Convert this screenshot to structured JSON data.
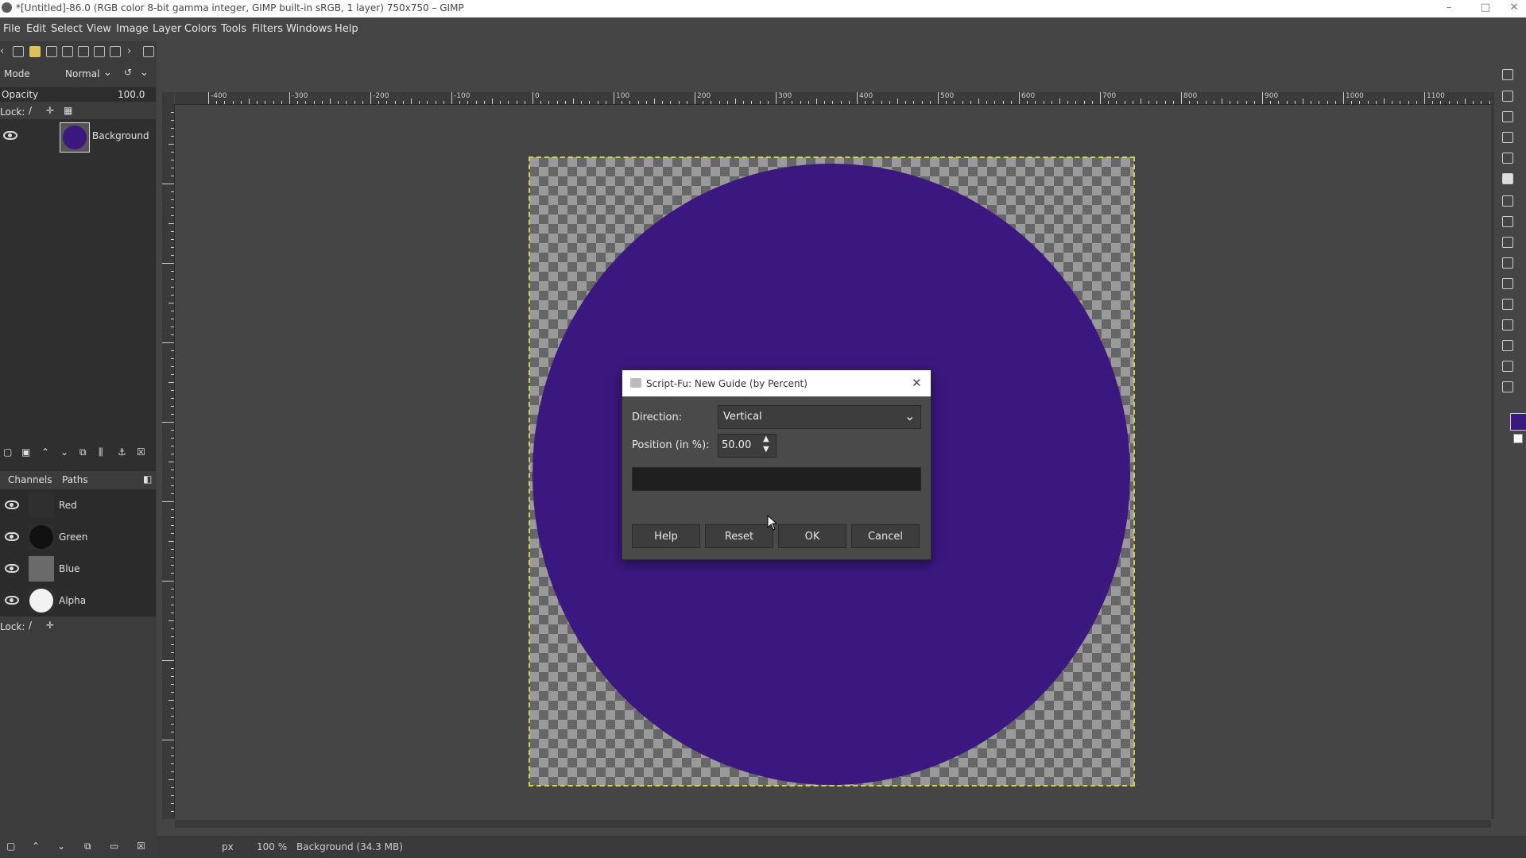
{
  "window": {
    "title": "*[Untitled]-86.0 (RGB color 8-bit gamma integer, GIMP built-in sRGB, 1 layer) 750x750 – GIMP",
    "minimize": "–",
    "maximize": "□",
    "close": "✕"
  },
  "menu": [
    "File",
    "Edit",
    "Select",
    "View",
    "Image",
    "Layer",
    "Colors",
    "Tools",
    "Filters",
    "Windows",
    "Help"
  ],
  "layers_panel": {
    "mode_label": "Mode",
    "mode_value": "Normal",
    "opacity_label": "Opacity",
    "opacity_value": "100.0",
    "lock_label": "Lock:",
    "layer_name": "Background"
  },
  "channels_panel": {
    "tabs": [
      "Channels",
      "Paths"
    ],
    "channels": [
      "Red",
      "Green",
      "Blue",
      "Alpha"
    ],
    "lock_label": "Lock:"
  },
  "ruler": {
    "top_labels": [
      "-400",
      "-300",
      "-200",
      "-100",
      "0",
      "100",
      "200",
      "300",
      "400",
      "500",
      "600",
      "700",
      "800",
      "900",
      "1000",
      "1100"
    ]
  },
  "dialog": {
    "title": "Script-Fu: New Guide (by Percent)",
    "direction_label": "Direction:",
    "direction_value": "Vertical",
    "position_label": "Position (in %):",
    "position_value": "50.00",
    "buttons": {
      "help": "Help",
      "reset": "Reset",
      "ok": "OK",
      "cancel": "Cancel"
    }
  },
  "statusbar": {
    "unit": "px",
    "zoom": "100 %",
    "info": "Background (34.3 MB)"
  },
  "colors": {
    "circle": "#3b1880",
    "foreground": "#3b1880"
  }
}
